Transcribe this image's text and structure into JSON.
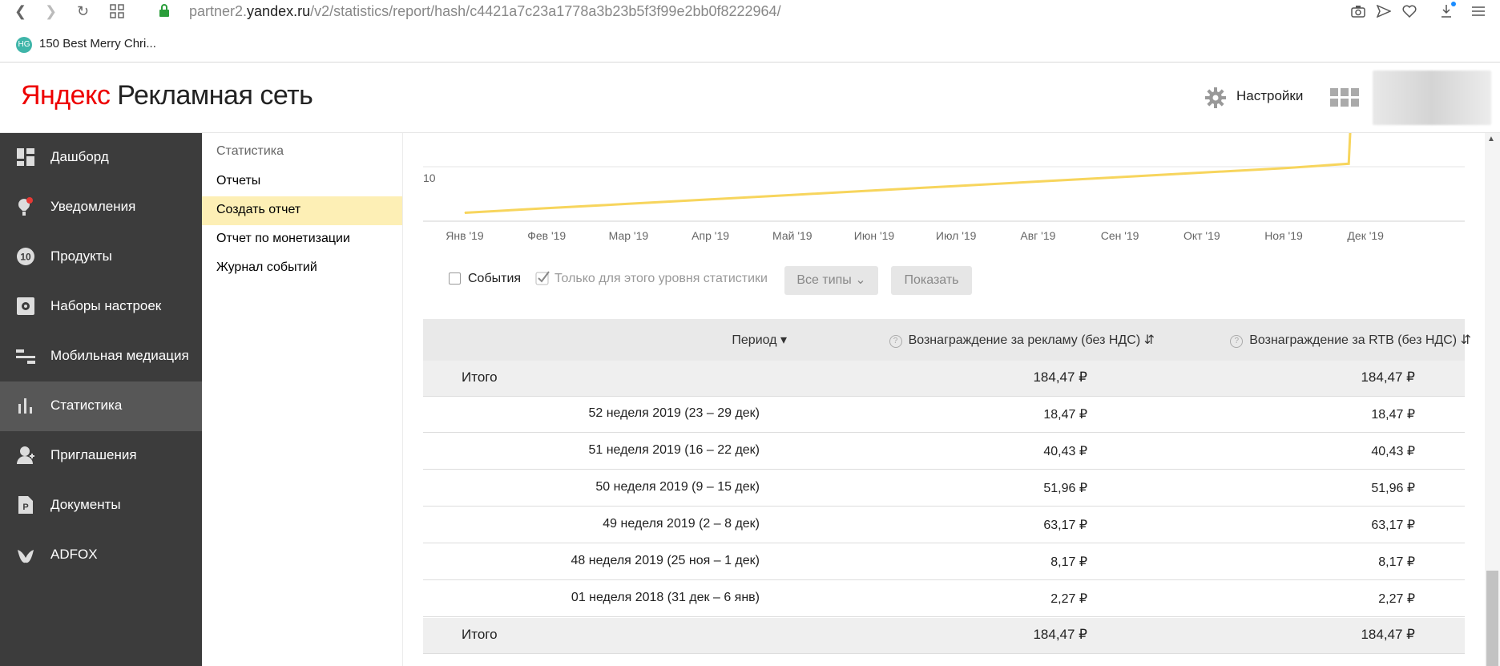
{
  "browser": {
    "url_prefix": "partner2.",
    "url_domain": "yandex.ru",
    "url_path": "/v2/statistics/report/hash/c4421a7c23a1778a3b23b5f3f99e2bb0f8222964/",
    "bookmark_icon_text": "HG",
    "bookmark_label": "150 Best Merry Chri..."
  },
  "header": {
    "logo_brand": "Яндекс",
    "logo_product": "Рекламная сеть",
    "settings_label": "Настройки"
  },
  "sidebar": {
    "items": [
      {
        "label": "Дашборд",
        "icon": "dashboard-icon"
      },
      {
        "label": "Уведомления",
        "icon": "notification-icon"
      },
      {
        "label": "Продукты",
        "icon": "products-icon"
      },
      {
        "label": "Наборы настроек",
        "icon": "settings-set-icon"
      },
      {
        "label": "Мобильная медиация",
        "icon": "mediation-icon"
      },
      {
        "label": "Статистика",
        "icon": "statistics-icon"
      },
      {
        "label": "Приглашения",
        "icon": "invite-icon"
      },
      {
        "label": "Документы",
        "icon": "document-icon"
      },
      {
        "label": "ADFOX",
        "icon": "adfox-icon"
      }
    ],
    "active": "Статистика"
  },
  "subnav": {
    "title": "Статистика",
    "items": [
      "Отчеты",
      "Создать отчет",
      "Отчет по монетизации",
      "Журнал событий"
    ],
    "active": "Создать отчет"
  },
  "chart_data": {
    "type": "line",
    "categories": [
      "Янв '19",
      "Фев '19",
      "Мар '19",
      "Апр '19",
      "Май '19",
      "Июн '19",
      "Июл '19",
      "Авг '19",
      "Сен '19",
      "Окт '19",
      "Ноя '19",
      "Дек '19"
    ],
    "y_tick_visible": "10",
    "line_color": "#f7d55d",
    "series": [
      {
        "values": [
          2.27,
          3.5,
          4.7,
          5.9,
          7.1,
          8.3,
          9.5,
          10.7,
          11.9,
          13.1,
          14.3,
          15.5
        ]
      }
    ],
    "note_values": "approximate — upper portion of chart cropped; line rises sharply at end of Dec '19"
  },
  "controls": {
    "events_label": "События",
    "events_checked": false,
    "level_only_label": "Только для этого уровня статистики",
    "level_only_checked": true,
    "types_button": "Все типы",
    "show_button": "Показать"
  },
  "table": {
    "headers": {
      "period": "Период",
      "ads": "Вознаграждение за рекламу (без НДС)",
      "rtb": "Вознаграждение за RTB (без НДС)"
    },
    "total_label": "Итого",
    "total_ads": "184,47 ₽",
    "total_rtb": "184,47 ₽",
    "rows": [
      {
        "period": "52 неделя 2019 (23 – 29 дек)",
        "ads": "18,47 ₽",
        "rtb": "18,47 ₽"
      },
      {
        "period": "51 неделя 2019 (16 – 22 дек)",
        "ads": "40,43 ₽",
        "rtb": "40,43 ₽"
      },
      {
        "period": "50 неделя 2019 (9 – 15 дек)",
        "ads": "51,96 ₽",
        "rtb": "51,96 ₽"
      },
      {
        "period": "49 неделя 2019 (2 – 8 дек)",
        "ads": "63,17 ₽",
        "rtb": "63,17 ₽"
      },
      {
        "period": "48 неделя 2019 (25 ноя – 1 дек)",
        "ads": "8,17 ₽",
        "rtb": "8,17 ₽"
      },
      {
        "period": "01 неделя 2018 (31 дек – 6 янв)",
        "ads": "2,27 ₽",
        "rtb": "2,27 ₽"
      }
    ]
  }
}
